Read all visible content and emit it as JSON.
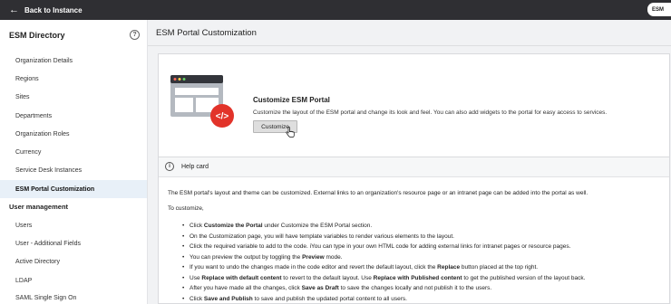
{
  "topbar": {
    "back_label": "Back to Instance",
    "chip_label": "ESM"
  },
  "sidebar": {
    "title": "ESM Directory",
    "help_glyph": "?",
    "items": [
      {
        "label": "Organization Details"
      },
      {
        "label": "Regions"
      },
      {
        "label": "Sites"
      },
      {
        "label": "Departments"
      },
      {
        "label": "Organization Roles"
      },
      {
        "label": "Currency"
      },
      {
        "label": "Service Desk Instances"
      },
      {
        "label": "ESM Portal Customization",
        "active": true
      }
    ],
    "section_title": "User management",
    "user_items": [
      {
        "label": "Users"
      },
      {
        "label": "User - Additional Fields"
      },
      {
        "label": "Active Directory"
      },
      {
        "label": "LDAP"
      },
      {
        "label": "SAML Single Sign On"
      }
    ]
  },
  "main": {
    "page_title": "ESM Portal Customization",
    "customize_card": {
      "title": "Customize ESM Portal",
      "description": "Customize the layout of the ESM portal and change its look and feel. You can also add widgets to the portal for easy access to services.",
      "button_label": "Customize",
      "badge_glyph": "</>"
    },
    "help_card": {
      "title": "Help card",
      "info_glyph": "i",
      "intro": "The ESM portal's layout and theme can be customized. External links to an organization's resource page or an intranet page can be added into the portal as well.",
      "subhead": "To customize,",
      "steps": [
        {
          "parts": [
            {
              "t": "Click "
            },
            {
              "t": "Customize the Portal",
              "b": true
            },
            {
              "t": " under Customize the ESM Portal section."
            }
          ]
        },
        {
          "parts": [
            {
              "t": "On the Customization page, you will have template variables to render various elements to the layout."
            }
          ]
        },
        {
          "parts": [
            {
              "t": "Click the required variable to add to the code. iYou can type in your own HTML code for adding external links for intranet pages or resource pages."
            }
          ]
        },
        {
          "parts": [
            {
              "t": "You can preview the output by toggling the "
            },
            {
              "t": "Preview",
              "b": true
            },
            {
              "t": " mode."
            }
          ]
        },
        {
          "parts": [
            {
              "t": "If you want to undo the changes made in the code editor and revert the default layout, click the "
            },
            {
              "t": "Replace",
              "b": true
            },
            {
              "t": " button placed at the top right."
            }
          ]
        },
        {
          "parts": [
            {
              "t": "Use "
            },
            {
              "t": "Replace with default content",
              "b": true
            },
            {
              "t": " to revert to the default layout. Use "
            },
            {
              "t": "Replace with Published content",
              "b": true
            },
            {
              "t": " to get the published version of the layout back."
            }
          ]
        },
        {
          "parts": [
            {
              "t": "After you have made all the changes, click "
            },
            {
              "t": "Save as Draft",
              "b": true
            },
            {
              "t": " to save the changes locally and not publish it to the users."
            }
          ]
        },
        {
          "parts": [
            {
              "t": "Click "
            },
            {
              "t": "Save and Publish",
              "b": true
            },
            {
              "t": " to save and publish the updated portal content to all users."
            }
          ]
        }
      ]
    }
  },
  "colors": {
    "topbar": "#2f2f33",
    "active_item_bg": "#e8f0f8",
    "badge_red": "#e2332a",
    "illustration_gray": "#b4b9c0",
    "illustration_window": "#33353b"
  }
}
